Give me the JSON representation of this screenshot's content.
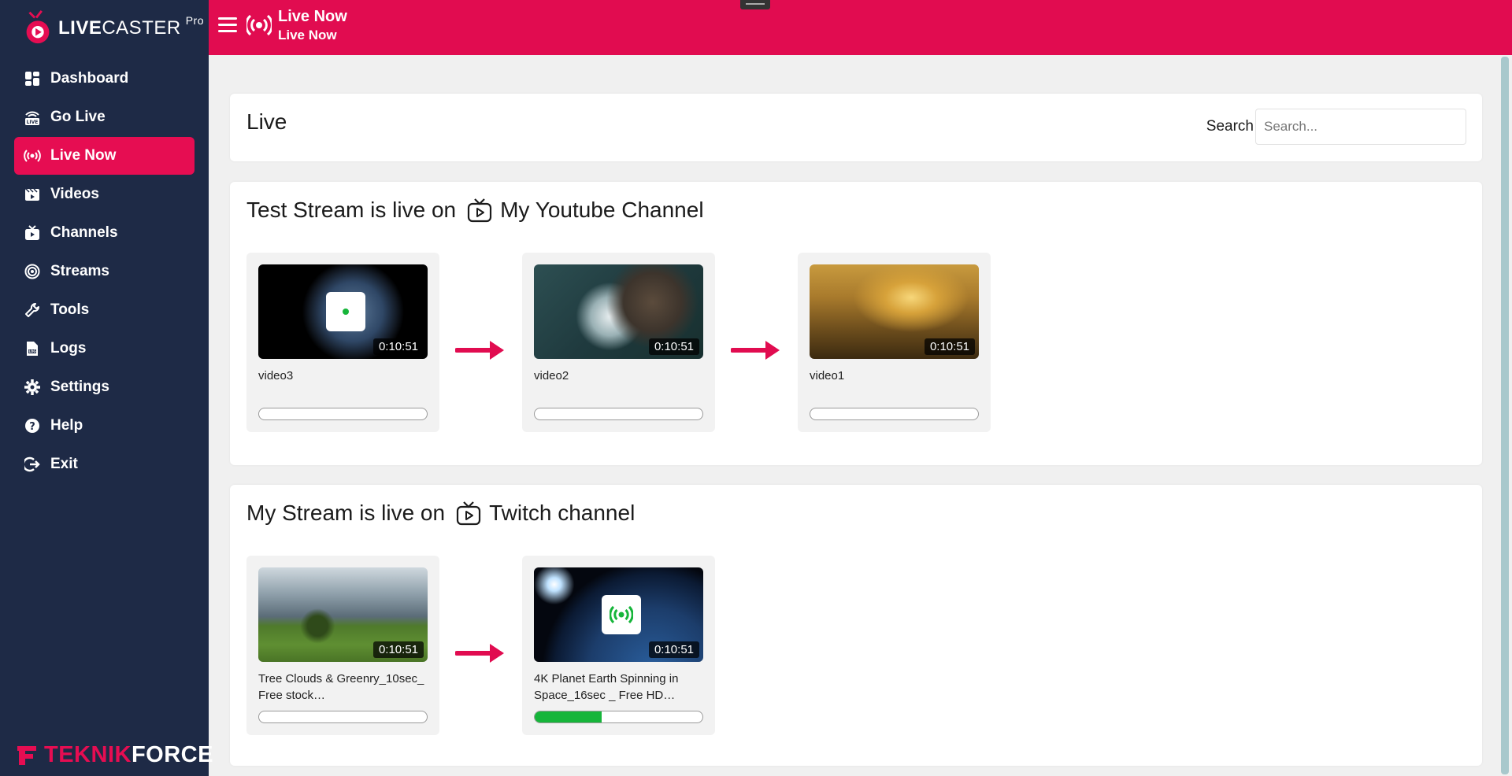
{
  "app": {
    "logo_bold": "LIVE",
    "logo_rest": "CASTER",
    "logo_tier": "Pro",
    "brand_left": "TEKNIK",
    "brand_right": "FORCE",
    "accent": "#e10c50",
    "sidebar_bg": "#1e2a46"
  },
  "sidebar": {
    "items": [
      {
        "label": "Dashboard",
        "icon": "dashboard-icon"
      },
      {
        "label": "Go Live",
        "icon": "go-live-icon"
      },
      {
        "label": "Live Now",
        "icon": "broadcast-icon",
        "active": true
      },
      {
        "label": "Videos",
        "icon": "video-icon"
      },
      {
        "label": "Channels",
        "icon": "tv-icon"
      },
      {
        "label": "Streams",
        "icon": "stream-icon"
      },
      {
        "label": "Tools",
        "icon": "tools-icon"
      },
      {
        "label": "Logs",
        "icon": "log-icon"
      },
      {
        "label": "Settings",
        "icon": "gear-icon"
      },
      {
        "label": "Help",
        "icon": "help-icon"
      },
      {
        "label": "Exit",
        "icon": "exit-icon"
      }
    ]
  },
  "header": {
    "title": "Live Now",
    "subtitle": "Live Now"
  },
  "live_panel": {
    "heading": "Live",
    "search_label": "Search",
    "search_placeholder": "Search...",
    "search_value": ""
  },
  "streams": [
    {
      "prefix": "Test Stream is live on",
      "channel": "My Youtube Channel",
      "videos": [
        {
          "name": "video3",
          "duration": "0:10:51",
          "progress": 0,
          "theme": "planet-dark",
          "badge": "dot"
        },
        {
          "name": "video2",
          "duration": "0:10:51",
          "progress": 0,
          "theme": "ocean-rocks"
        },
        {
          "name": "video1",
          "duration": "0:10:51",
          "progress": 0,
          "theme": "sunset-sea"
        }
      ]
    },
    {
      "prefix": "My Stream is live on",
      "channel": "Twitch channel",
      "videos": [
        {
          "name": "Tree Clouds & Greenry_10sec_ Free stock…",
          "duration": "0:10:51",
          "progress": 0,
          "theme": "tree-field"
        },
        {
          "name": "4K Planet Earth Spinning in Space_16sec _ Free HD…",
          "duration": "0:10:51",
          "progress": 0.4,
          "theme": "earth-space",
          "badge": "live"
        }
      ]
    }
  ]
}
